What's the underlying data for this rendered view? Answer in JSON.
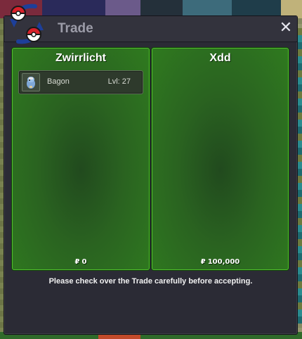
{
  "window": {
    "title": "Trade",
    "close_label": "✕",
    "accent_color": "#4fbf2a",
    "notice": "Please check over the Trade carefully before accepting."
  },
  "offers": {
    "left": {
      "player_name": "Zwirrlicht",
      "currency_symbol": "₽",
      "money": "0",
      "pokemon": [
        {
          "name": "Bagon",
          "level": "Lvl: 27",
          "icon": "bagon-sprite-icon"
        }
      ]
    },
    "right": {
      "player_name": "Xdd",
      "currency_symbol": "₽",
      "money": "100,000",
      "pokemon": []
    }
  }
}
